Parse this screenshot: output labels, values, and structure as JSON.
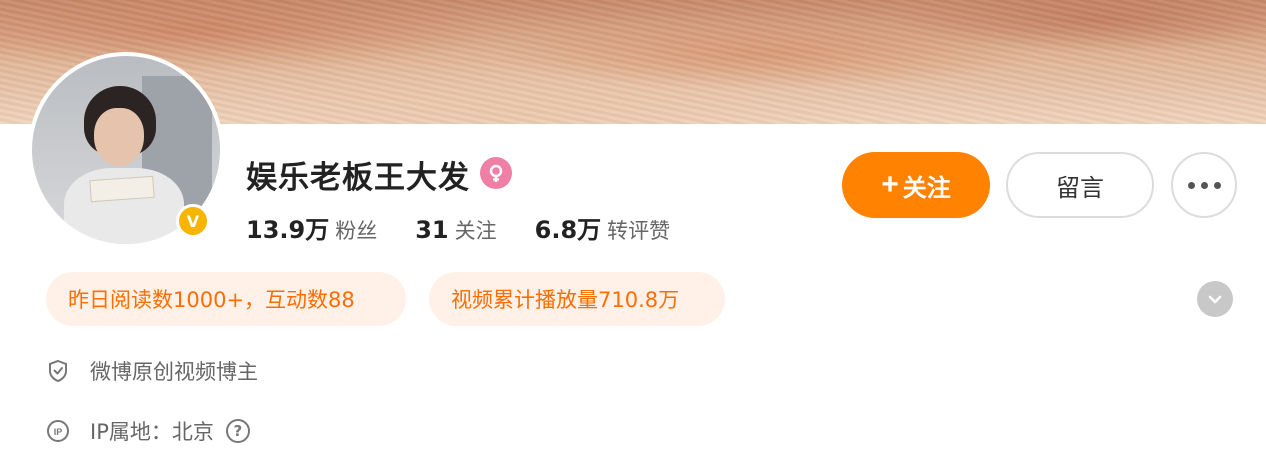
{
  "profile": {
    "name": "娱乐老板王大发",
    "gender_icon": "female-icon",
    "verified_icon": "verified-v-icon",
    "verified_glyph": "V"
  },
  "stats": [
    {
      "value": "13.9万",
      "label": "粉丝"
    },
    {
      "value": "31",
      "label": "关注"
    },
    {
      "value": "6.8万",
      "label": "转评赞"
    }
  ],
  "actions": {
    "follow_plus": "+",
    "follow_label": "关注",
    "message_label": "留言",
    "more_icon": "more-dots-icon"
  },
  "highlights": [
    "昨日阅读数1000+，互动数88",
    "视频累计播放量710.8万"
  ],
  "info": {
    "certification": "微博原创视频博主",
    "ip_location": "IP属地：北京",
    "help_glyph": "?"
  },
  "colors": {
    "accent": "#ff8200",
    "highlight_text": "#ff6d00",
    "highlight_bg": "#fff1e8",
    "verified": "#f7b500",
    "gender": "#f07fa6"
  }
}
